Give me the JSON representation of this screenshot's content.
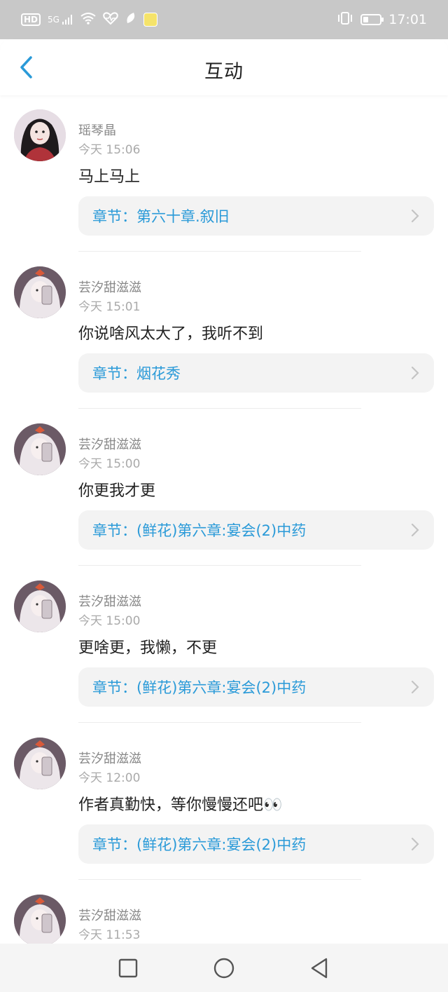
{
  "status_bar": {
    "hd": "HD",
    "network": "5G",
    "time": "17:01",
    "icons": [
      "hd-icon",
      "signal-icon",
      "wifi-icon",
      "health-icon",
      "leaf-icon",
      "app-notification-icon",
      "vibrate-icon",
      "battery-icon"
    ]
  },
  "header": {
    "title": "互动",
    "back_icon": "chevron-left-icon"
  },
  "accent_color": "#2a9ad8",
  "items": [
    {
      "username": "瑶琴晶",
      "time": "今天 15:06",
      "message": "马上马上",
      "chapter": "章节：第六十章.叙旧",
      "avatar": "avatar-girl-red"
    },
    {
      "username": "芸汐甜滋滋",
      "time": "今天 15:01",
      "message": "你说啥风太大了，我听不到",
      "chapter": "章节：烟花秀",
      "avatar": "avatar-white-hair"
    },
    {
      "username": "芸汐甜滋滋",
      "time": "今天 15:00",
      "message": "你更我才更",
      "chapter": "章节：(鲜花)第六章:宴会(2)中药",
      "avatar": "avatar-white-hair"
    },
    {
      "username": "芸汐甜滋滋",
      "time": "今天 15:00",
      "message": "更啥更，我懒，不更",
      "chapter": "章节：(鲜花)第六章:宴会(2)中药",
      "avatar": "avatar-white-hair"
    },
    {
      "username": "芸汐甜滋滋",
      "time": "今天 12:00",
      "message": "作者真勤快，等你慢慢还吧👀",
      "chapter": "章节：(鲜花)第六章:宴会(2)中药",
      "avatar": "avatar-white-hair"
    },
    {
      "username": "芸汐甜滋滋",
      "time": "今天 11:53",
      "message": "",
      "chapter": "",
      "avatar": "avatar-white-hair"
    }
  ],
  "nav_bar": {
    "icons": [
      "square-recents-icon",
      "circle-home-icon",
      "triangle-back-icon"
    ]
  }
}
